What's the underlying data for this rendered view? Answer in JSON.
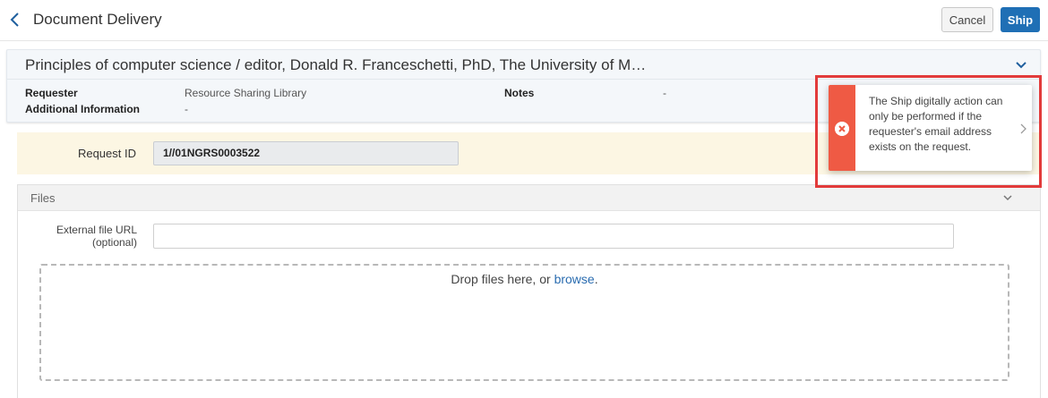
{
  "header": {
    "title": "Document Delivery",
    "cancel_label": "Cancel",
    "ship_label": "Ship"
  },
  "record": {
    "title": "Principles of computer science / editor, Donald R. Franceschetti, PhD, The University of M…",
    "fields": {
      "requester_label": "Requester",
      "requester_value": "Resource Sharing Library",
      "additional_info_label": "Additional Information",
      "additional_info_value": "-",
      "notes_label": "Notes",
      "notes_value": "-"
    }
  },
  "request": {
    "label": "Request ID",
    "value": "1//01NGRS0003522"
  },
  "files": {
    "title": "Files",
    "external_url_label_line1": "External file URL",
    "external_url_label_line2": "(optional)",
    "external_url_value": "",
    "drop_text": "Drop files here, or ",
    "browse_label": "browse",
    "drop_text_end": "."
  },
  "toast": {
    "message": "The Ship digitally action can only be performed if the requester's email address exists on the request.",
    "icon": "error-circle-icon"
  },
  "colors": {
    "primary": "#1f6fb5",
    "error": "#ef5a44",
    "highlight": "#e23b3b",
    "request_bg": "#fcf6e3",
    "link": "#2a6cb0"
  }
}
